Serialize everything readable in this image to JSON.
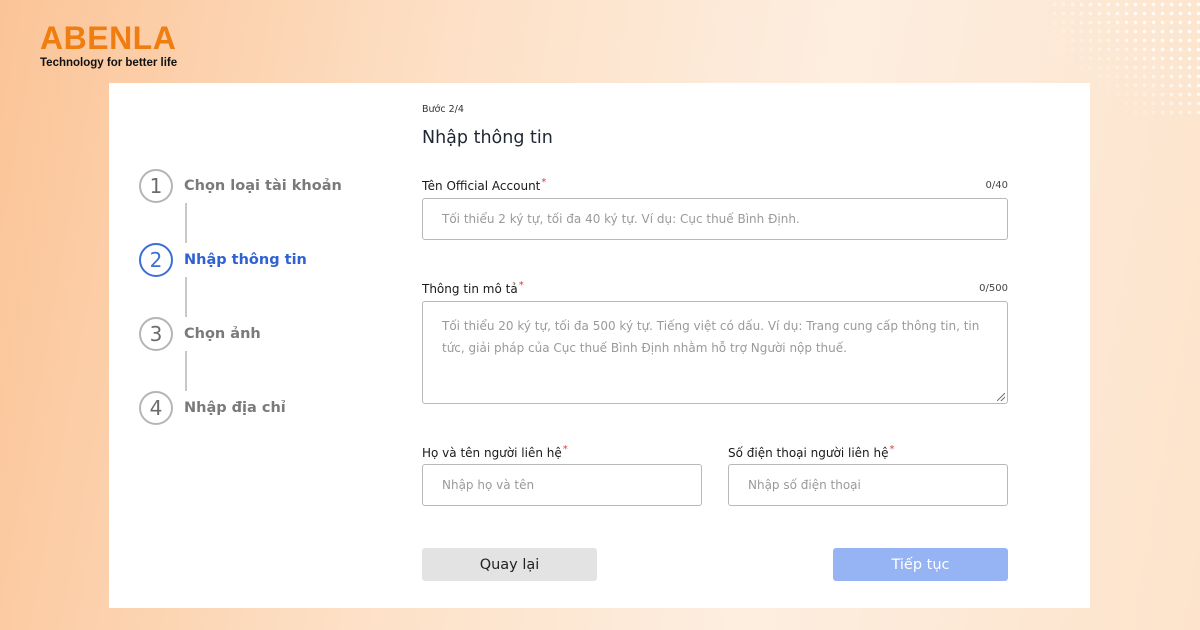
{
  "brand": {
    "name": "ABENLA",
    "tagline": "Technology for better life",
    "accent": "#f07d0f"
  },
  "steps": [
    {
      "number": "1",
      "label": "Chọn loại tài khoản",
      "active": false
    },
    {
      "number": "2",
      "label": "Nhập thông tin",
      "active": true
    },
    {
      "number": "3",
      "label": "Chọn ảnh",
      "active": false
    },
    {
      "number": "4",
      "label": "Nhập địa chỉ",
      "active": false
    }
  ],
  "form": {
    "step_indicator": "Bước 2/4",
    "title": "Nhập thông tin",
    "required_mark": "*",
    "oa_name": {
      "label": "Tên Official Account",
      "counter": "0/40",
      "value": "",
      "placeholder": "Tối thiểu 2 ký tự, tối đa 40 ký tự. Ví dụ: Cục thuế Bình Định."
    },
    "description": {
      "label": "Thông tin mô tả",
      "counter": "0/500",
      "value": "",
      "placeholder": "Tối thiểu 20 ký tự, tối đa 500 ký tự. Tiếng việt có dấu. Ví dụ: Trang cung cấp thông tin, tin tức, giải pháp của Cục thuế Bình Định nhằm hỗ trợ Người nộp thuế."
    },
    "contact_name": {
      "label": "Họ và tên người liên hệ",
      "value": "",
      "placeholder": "Nhập họ và tên"
    },
    "contact_phone": {
      "label": "Số điện thoại người liên hệ",
      "value": "",
      "placeholder": "Nhập số điện thoại"
    },
    "back_label": "Quay lại",
    "next_label": "Tiếp tục"
  },
  "colors": {
    "active_step": "#2f62d4",
    "next_button": "#96b4f4",
    "back_button": "#e3e3e3",
    "required": "#e03b3b"
  }
}
